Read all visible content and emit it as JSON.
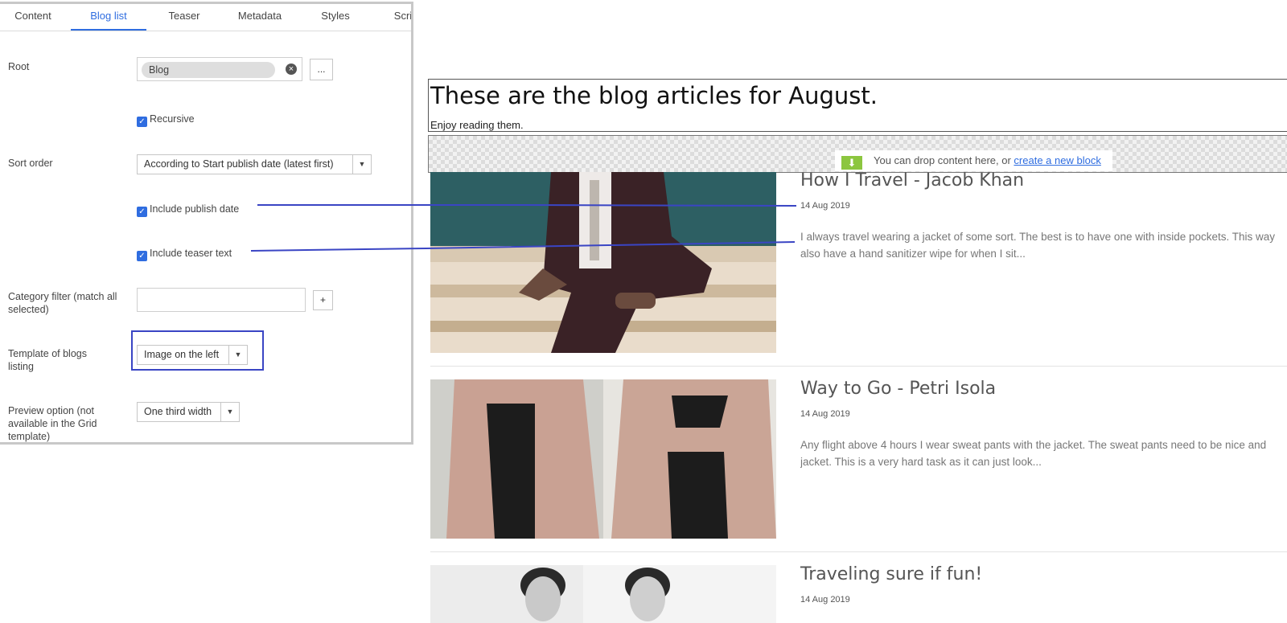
{
  "tabs": [
    "Content",
    "Blog list",
    "Teaser",
    "Metadata",
    "Styles",
    "Scri"
  ],
  "settings": {
    "root_label": "Root",
    "root_value": "Blog",
    "browse_label": "...",
    "recursive_label": "Recursive",
    "sort_label": "Sort order",
    "sort_value": "According to Start publish date (latest first)",
    "publish_date_label": "Include publish date",
    "teaser_label": "Include teaser text",
    "category_label": "Category filter (match all selected)",
    "add_label": "+",
    "template_label": "Template of blogs listing",
    "template_value": "Image on the left",
    "preview_label": "Preview option (not available in the Grid template)",
    "preview_value": "One third width"
  },
  "preview": {
    "heading": "These are the blog articles for August.",
    "subheading": "Enjoy reading them.",
    "drop_text": "You can drop content here, or ",
    "drop_link": "create a new block"
  },
  "posts": [
    {
      "title": "How I Travel - Jacob Khan",
      "date": "14 Aug 2019",
      "teaser_l1": "I always travel wearing a jacket of some sort. The best is to have one with inside pockets. This way",
      "teaser_l2": "also have a hand sanitizer wipe for when I sit..."
    },
    {
      "title": "Way to Go - Petri Isola",
      "date": "14 Aug 2019",
      "teaser_l1": "Any flight above 4 hours I wear sweat pants with the jacket. The sweat pants need to be nice and",
      "teaser_l2": "jacket. This is a very hard task as it can just look..."
    },
    {
      "title": "Traveling sure if fun!",
      "date": "14 Aug 2019",
      "teaser_l1": "",
      "teaser_l2": ""
    }
  ],
  "colors": {
    "accent": "#2f6de0",
    "annotation": "#3a45c4",
    "drop_icon": "#8cc63f"
  }
}
